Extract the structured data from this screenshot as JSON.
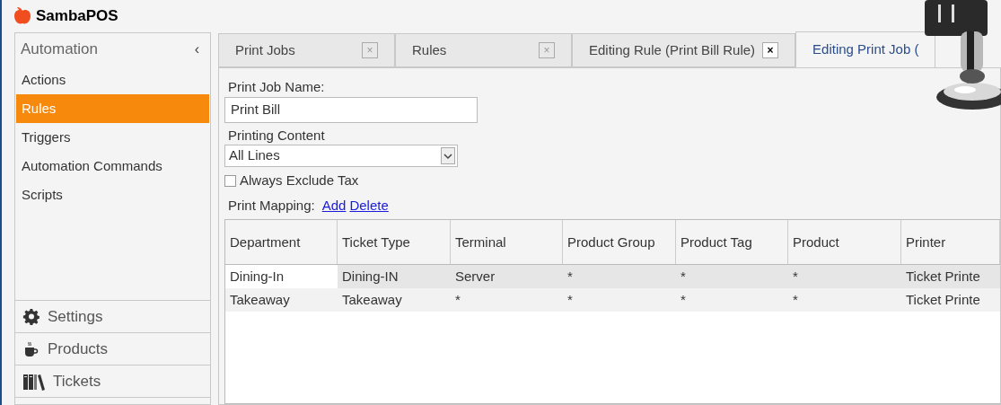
{
  "app": {
    "title": "SambaPOS"
  },
  "sidebar": {
    "header": "Automation",
    "collapse_glyph": "‹",
    "items": [
      {
        "label": "Actions",
        "selected": false
      },
      {
        "label": "Rules",
        "selected": true
      },
      {
        "label": "Triggers",
        "selected": false
      },
      {
        "label": "Automation Commands",
        "selected": false
      },
      {
        "label": "Scripts",
        "selected": false
      }
    ],
    "sections": [
      {
        "label": "Settings",
        "kind": "gear"
      },
      {
        "label": "Products",
        "kind": "cup"
      },
      {
        "label": "Tickets",
        "kind": "books"
      }
    ]
  },
  "tabs": [
    {
      "label": "Print Jobs",
      "close": "×",
      "selected": false
    },
    {
      "label": "Rules",
      "close": "×",
      "selected": false
    },
    {
      "label": "Editing Rule (Print Bill Rule)",
      "close": "×",
      "selected": false
    },
    {
      "label": "Editing Print Job (",
      "selected": true
    }
  ],
  "form": {
    "name_label": "Print Job Name:",
    "name_value": "Print Bill",
    "content_label": "Printing Content",
    "content_value": "All Lines",
    "exclude_tax": {
      "label": "Always Exclude Tax",
      "checked": false
    },
    "mapping_label": "Print Mapping:",
    "links": [
      "Add",
      "Delete"
    ]
  },
  "table": {
    "columns": [
      "Department",
      "Ticket Type",
      "Terminal",
      "Product Group",
      "Product Tag",
      "Product",
      "Printer"
    ],
    "rows": [
      {
        "selected": true,
        "cells": [
          "Dining-In",
          "Dining-IN",
          "Server",
          "*",
          "*",
          "*",
          "Ticket Printe"
        ]
      },
      {
        "selected": false,
        "cells": [
          "Takeaway",
          "Takeaway",
          "*",
          "*",
          "*",
          "*",
          "Ticket Printe"
        ]
      }
    ]
  }
}
